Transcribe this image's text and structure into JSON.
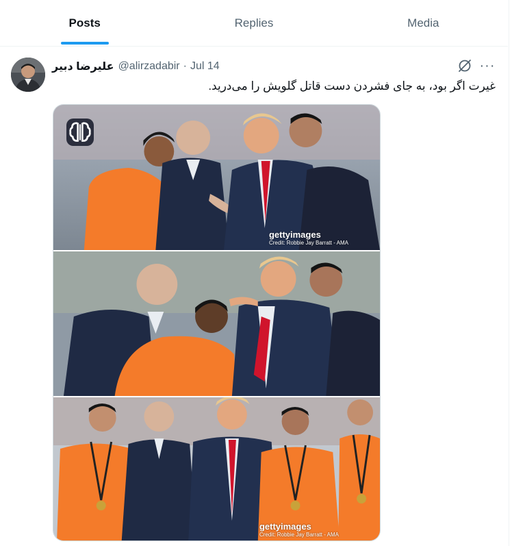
{
  "tabs": [
    {
      "label": "Posts",
      "active": true
    },
    {
      "label": "Replies",
      "active": false
    },
    {
      "label": "Media",
      "active": false
    }
  ],
  "tweet": {
    "display_name": "علیرضا دبیر",
    "handle": "@alirzadabir",
    "separator": "·",
    "date": "Jul 14",
    "text": "غیرت اگر بود، به جای فشردن دست قاتل گلویش را می‌درید.",
    "more_label": "···",
    "icons": {
      "grok": "grok-icon",
      "more": "more-icon",
      "ai_badge": "brain-icon"
    }
  },
  "media": {
    "watermark_brand": "gettyimages",
    "watermark_credit": "Credit: Robbie Jay Barratt - AMA"
  },
  "colors": {
    "accent": "#1d9bf0",
    "text": "#0f1419",
    "muted": "#536471",
    "referee_orange": "#f47b2a"
  }
}
